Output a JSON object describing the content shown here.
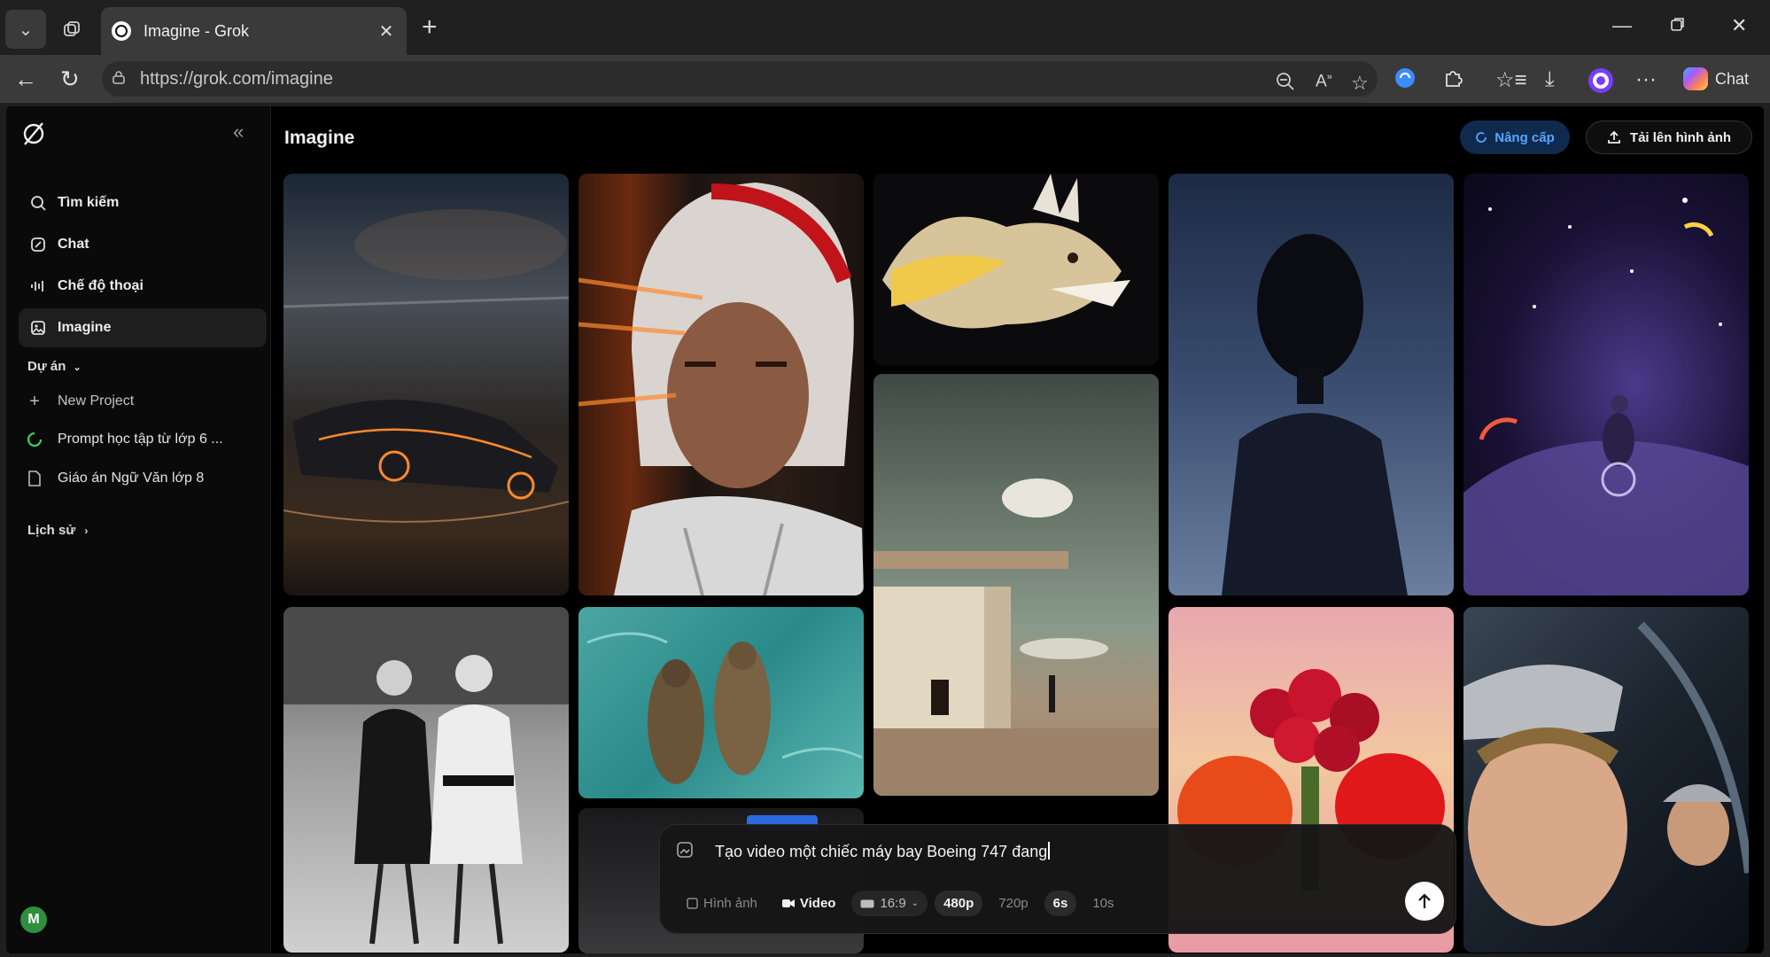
{
  "browser": {
    "tab_title": "Imagine - Grok",
    "url": "https://grok.com/imagine",
    "chat_label": "Chat"
  },
  "sidebar": {
    "items": [
      {
        "label": "Tìm kiếm",
        "icon": "search-icon"
      },
      {
        "label": "Chat",
        "icon": "edit-icon"
      },
      {
        "label": "Chế độ thoại",
        "icon": "voice-wave-icon"
      },
      {
        "label": "Imagine",
        "icon": "image-icon",
        "active": true
      }
    ],
    "projects_heading": "Dự án",
    "new_project": "New Project",
    "projects": [
      {
        "label": "Prompt học tập từ lớp 6 ...",
        "icon": "progress-icon"
      },
      {
        "label": "Giáo án Ngữ Văn lớp 8",
        "icon": "document-icon"
      }
    ],
    "history_heading": "Lịch sử",
    "avatar_initial": "M"
  },
  "header": {
    "title": "Imagine",
    "upgrade_label": "Nâng cấp",
    "upload_label": "Tải lên hình ảnh"
  },
  "gallery": [
    "futuristic-car-image",
    "racing-driver-image",
    "golden-dragon-fish-image",
    "dark-figure-image",
    "cosmic-cyclist-image",
    "vintage-women-image",
    "otters-image",
    "minimal-building-image",
    "roses-tomatoes-image",
    "young-astronaut-image",
    "car-interior-image"
  ],
  "composer": {
    "prompt_text": "Tạo video một chiếc máy bay Boeing 747 đang",
    "mode_image": "Hình ảnh",
    "mode_video": "Video",
    "aspect": "16:9",
    "res_480": "480p",
    "res_720": "720p",
    "dur_6": "6s",
    "dur_10": "10s"
  },
  "colors": {
    "accent_blue": "#58a6ff",
    "background": "#000000",
    "sidebar": "#0a0a0a"
  }
}
